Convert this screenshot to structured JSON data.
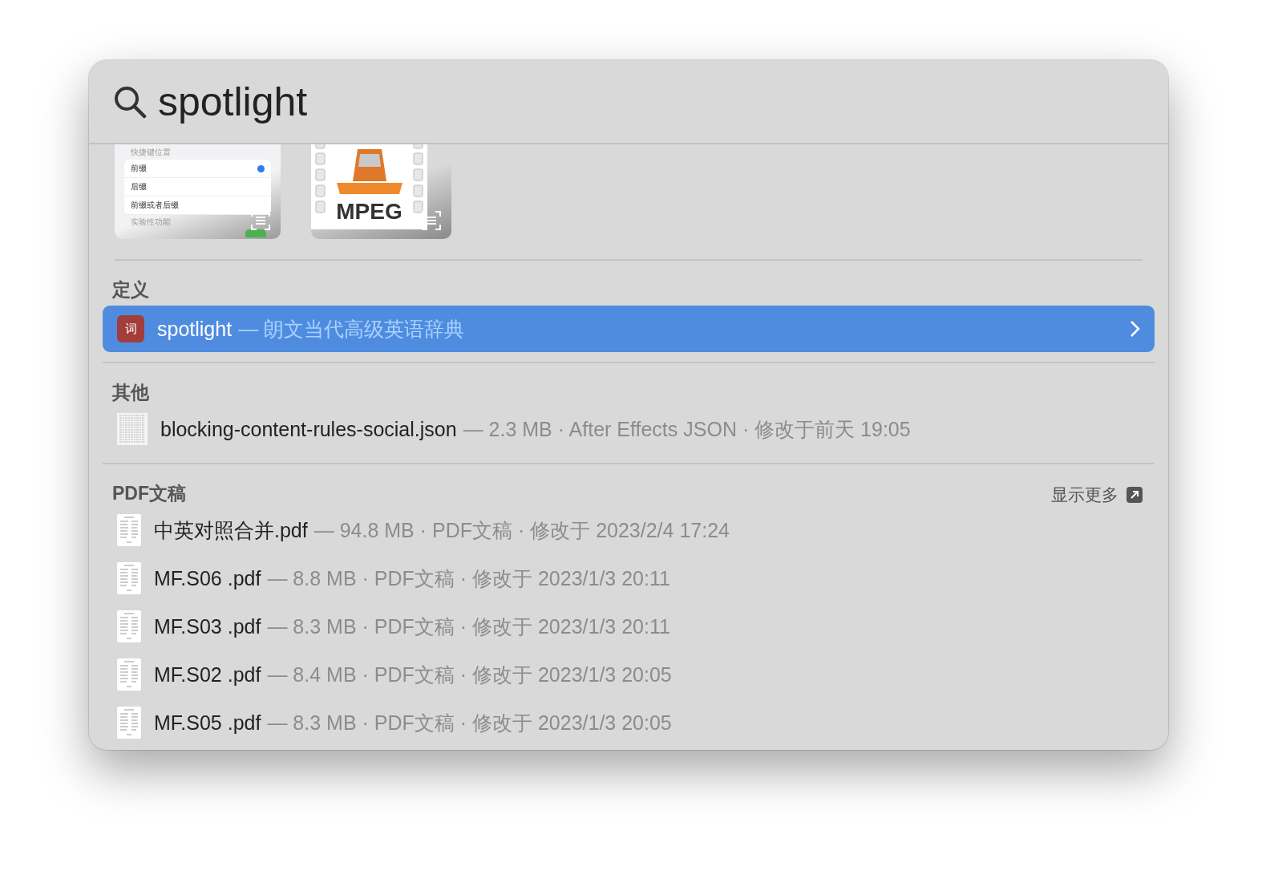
{
  "search": {
    "value": "spotlight"
  },
  "thumbnails": [
    {
      "kind": "screenshot",
      "header": "快捷键位置",
      "options": [
        {
          "label": "前缀",
          "checked": true
        },
        {
          "label": "后缀",
          "checked": false
        },
        {
          "label": "前缀或者后缀",
          "checked": false
        }
      ],
      "footer": "实验性功能",
      "toggle_on": true
    },
    {
      "kind": "video",
      "label": "MPEG"
    }
  ],
  "sections": [
    {
      "title": "定义",
      "items": [
        {
          "kind": "dictionary",
          "icon_text": "词",
          "name": "spotlight",
          "detail": "— 朗文当代高级英语辞典",
          "selected": true
        }
      ]
    },
    {
      "title": "其他",
      "items": [
        {
          "kind": "json",
          "name": "blocking-content-rules-social.json",
          "detail": "— 2.3 MB · After Effects JSON · 修改于前天 19:05",
          "selected": false
        }
      ]
    },
    {
      "title": "PDF文稿",
      "show_more": "显示更多",
      "items": [
        {
          "kind": "pdf",
          "name": "中英对照合并.pdf",
          "detail": "— 94.8 MB · PDF文稿 · 修改于 2023/2/4 17:24",
          "selected": false
        },
        {
          "kind": "pdf",
          "name": "MF.S06 .pdf",
          "detail": "— 8.8 MB · PDF文稿 · 修改于 2023/1/3 20:11",
          "selected": false
        },
        {
          "kind": "pdf",
          "name": "MF.S03 .pdf",
          "detail": "— 8.3 MB · PDF文稿 · 修改于 2023/1/3 20:11",
          "selected": false
        },
        {
          "kind": "pdf",
          "name": "MF.S02 .pdf",
          "detail": "— 8.4 MB · PDF文稿 · 修改于 2023/1/3 20:05",
          "selected": false
        },
        {
          "kind": "pdf",
          "name": "MF.S05 .pdf",
          "detail": "— 8.3 MB · PDF文稿 · 修改于 2023/1/3 20:05",
          "selected": false
        }
      ]
    }
  ]
}
